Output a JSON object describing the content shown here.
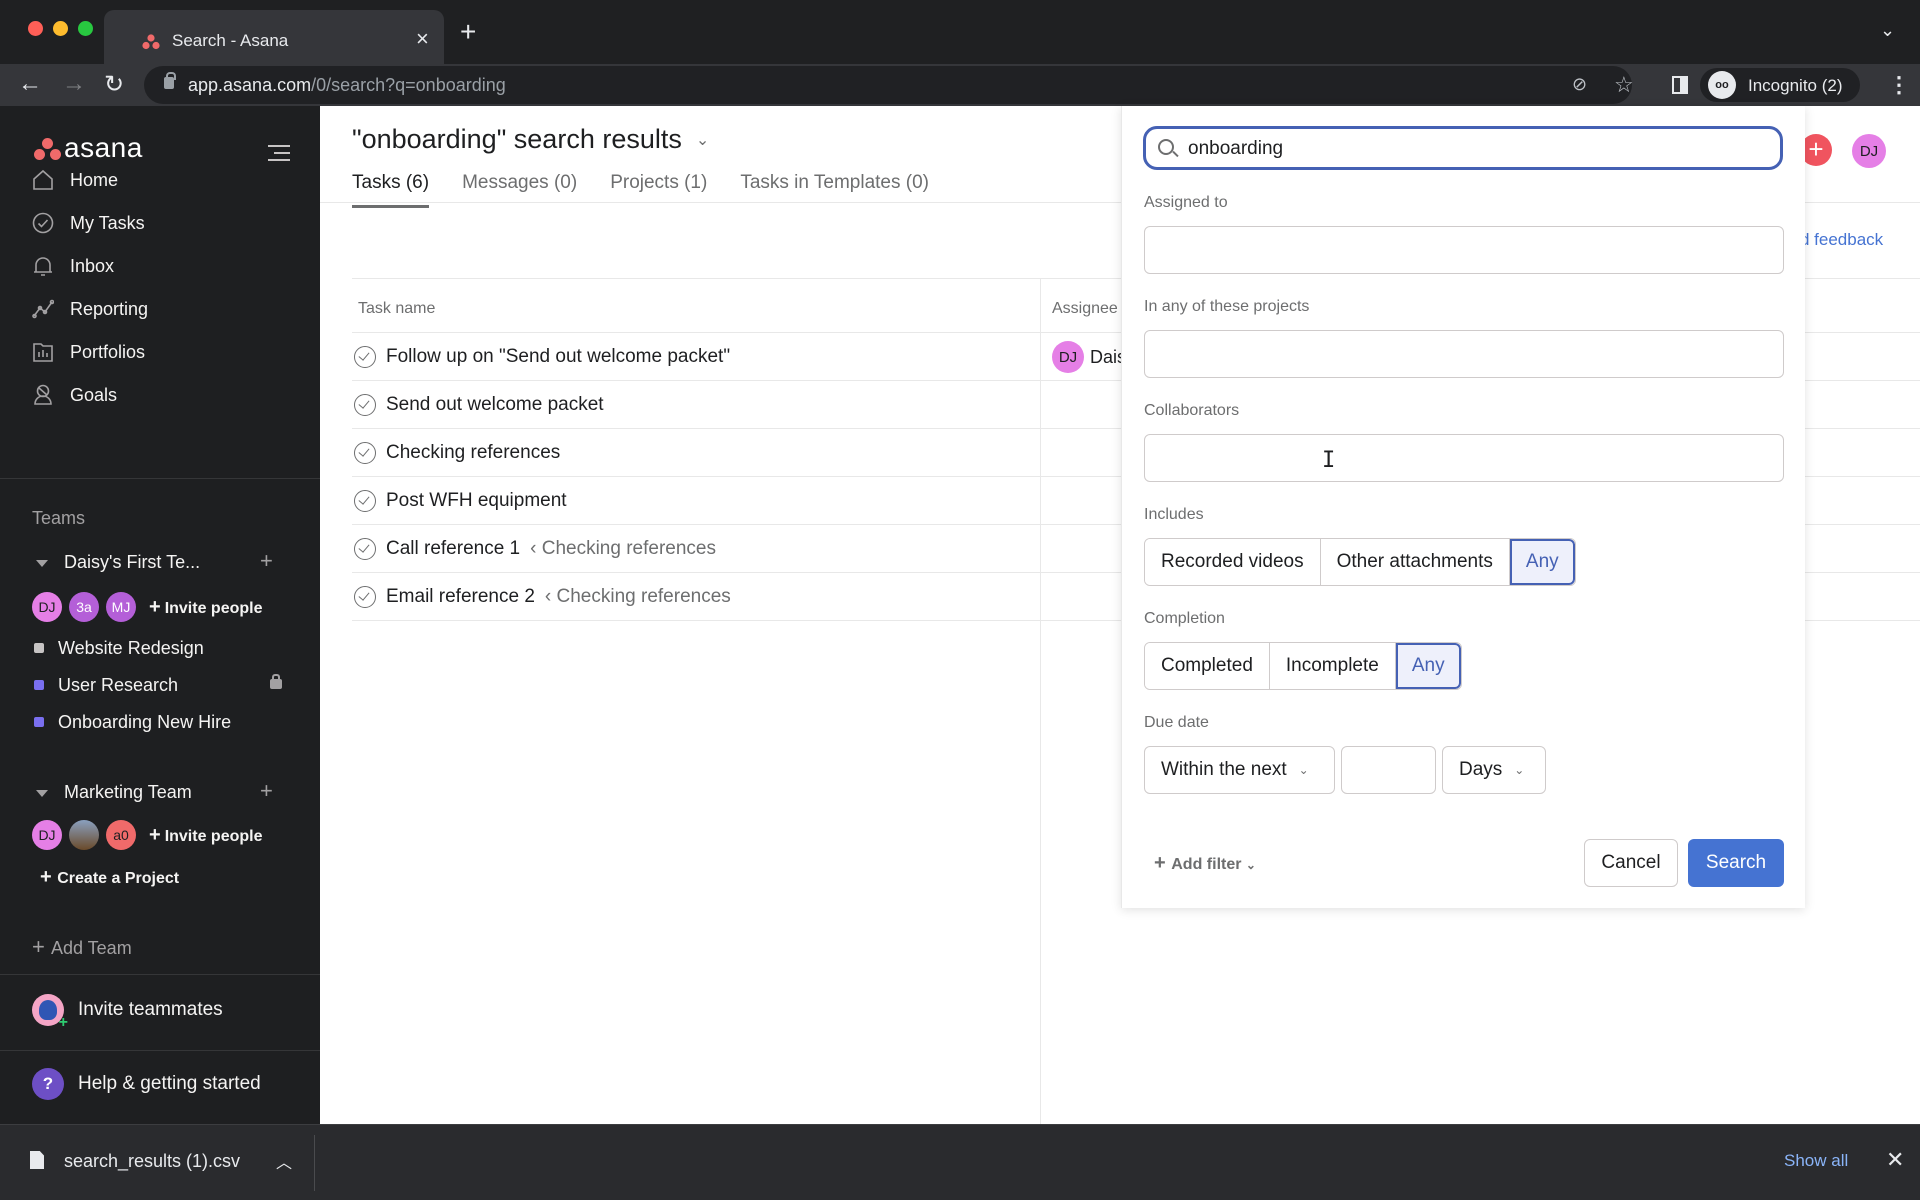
{
  "browser": {
    "tab_title": "Search - Asana",
    "url_host": "app.asana.com",
    "url_path": "/0/search?q=onboarding",
    "profile_label": "Incognito (2)",
    "traffic_colors": [
      "#ff5f57",
      "#febc2e",
      "#28c840"
    ]
  },
  "sidebar": {
    "logo_text": "asana",
    "nav": [
      {
        "label": "Home",
        "icon": "home-icon"
      },
      {
        "label": "My Tasks",
        "icon": "check-circle-icon"
      },
      {
        "label": "Inbox",
        "icon": "bell-icon"
      },
      {
        "label": "Reporting",
        "icon": "line-chart-icon"
      },
      {
        "label": "Portfolios",
        "icon": "portfolio-icon"
      },
      {
        "label": "Goals",
        "icon": "goals-icon"
      }
    ],
    "teams_heading": "Teams",
    "teams": [
      {
        "name": "Daisy's First Te...",
        "members": [
          {
            "initials": "DJ",
            "color": "#e57fe6"
          },
          {
            "initials": "3a",
            "color": "#b45fd8"
          },
          {
            "initials": "MJ",
            "color": "#b45fd8"
          }
        ],
        "invite_label": "Invite people",
        "projects": [
          {
            "name": "Website Redesign",
            "color": "#c7c4c4",
            "private": false
          },
          {
            "name": "User Research",
            "color": "#7a6ff0",
            "private": true
          },
          {
            "name": "Onboarding New Hire",
            "color": "#7a6ff0",
            "private": false
          }
        ]
      },
      {
        "name": "Marketing Team",
        "members": [
          {
            "initials": "DJ",
            "color": "#e57fe6"
          },
          {
            "initials": "",
            "color": "#8a7a6a"
          },
          {
            "initials": "a0",
            "color": "#f06a6a"
          }
        ],
        "invite_label": "Invite people",
        "create_project_label": "Create a Project"
      }
    ],
    "add_team_label": "Add Team",
    "invite_teammates_label": "Invite teammates",
    "help_label": "Help & getting started"
  },
  "main": {
    "title": "\"onboarding\" search results",
    "tabs": [
      {
        "label": "Tasks (6)",
        "active": true
      },
      {
        "label": "Messages (0)",
        "active": false
      },
      {
        "label": "Projects (1)",
        "active": false
      },
      {
        "label": "Tasks in Templates (0)",
        "active": false
      }
    ],
    "header_avatar": "DJ",
    "feedback_label": "d feedback",
    "columns": {
      "task_name": "Task name",
      "assignee": "Assignee"
    },
    "tasks": [
      {
        "name": "Follow up on \"Send out welcome packet\"",
        "parent": "",
        "assignee_initials": "DJ",
        "assignee_name": "Dais"
      },
      {
        "name": "Send out welcome packet",
        "parent": "",
        "assignee_initials": "",
        "assignee_name": ""
      },
      {
        "name": "Checking references",
        "parent": "",
        "assignee_initials": "",
        "assignee_name": ""
      },
      {
        "name": "Post WFH equipment",
        "parent": "",
        "assignee_initials": "",
        "assignee_name": ""
      },
      {
        "name": "Call reference 1",
        "parent": "‹ Checking references",
        "assignee_initials": "",
        "assignee_name": ""
      },
      {
        "name": "Email reference 2",
        "parent": "‹ Checking references",
        "assignee_initials": "",
        "assignee_name": ""
      }
    ]
  },
  "search_popover": {
    "query": "onboarding",
    "assigned_to_label": "Assigned to",
    "assigned_to_value": "",
    "projects_label": "In any of these projects",
    "projects_value": "",
    "collaborators_label": "Collaborators",
    "collaborators_value": "",
    "includes_label": "Includes",
    "includes_options": [
      "Recorded videos",
      "Other attachments",
      "Any"
    ],
    "includes_selected": "Any",
    "completion_label": "Completion",
    "completion_options": [
      "Completed",
      "Incomplete",
      "Any"
    ],
    "completion_selected": "Any",
    "due_date_label": "Due date",
    "due_date_mode": "Within the next",
    "due_date_amount": "",
    "due_date_unit": "Days",
    "add_filter_label": "Add filter",
    "cancel_label": "Cancel",
    "search_label": "Search",
    "accent_color": "#4573d2"
  },
  "download_bar": {
    "file_name": "search_results (1).csv",
    "show_all_label": "Show all"
  }
}
